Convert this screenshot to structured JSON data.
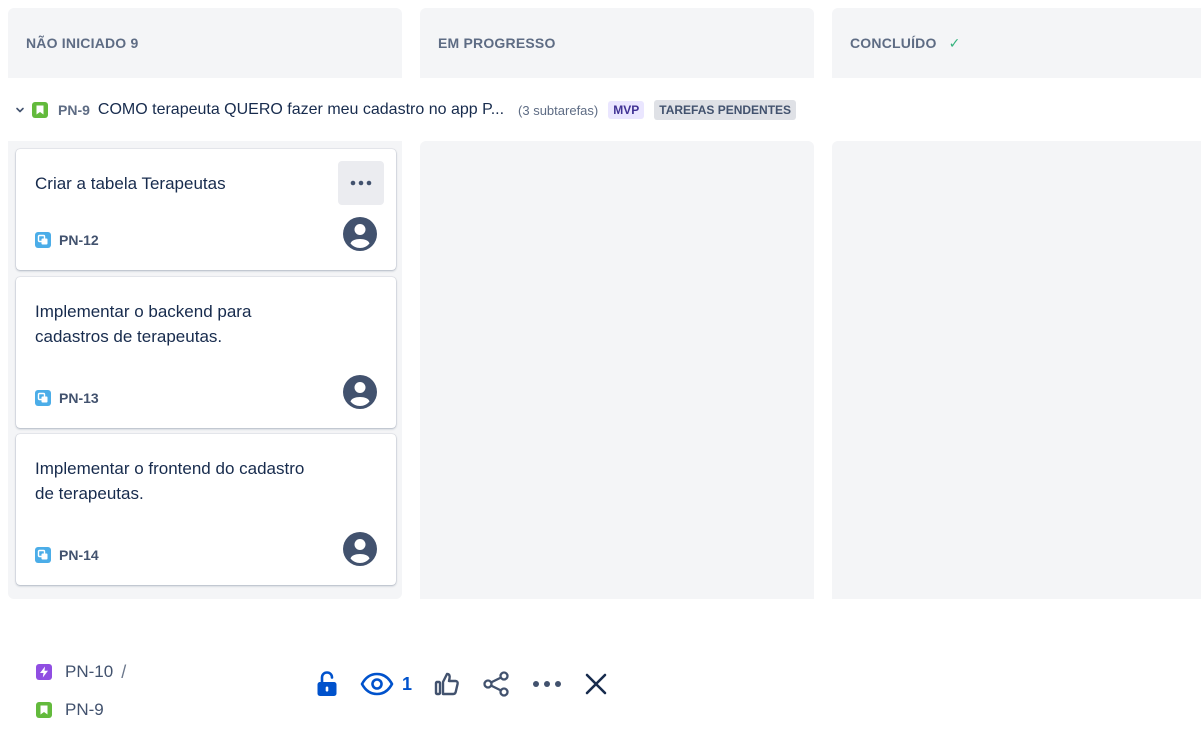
{
  "columns": [
    {
      "header": "NÃO INICIADO 9"
    },
    {
      "header": "EM PROGRESSO"
    },
    {
      "header": "CONCLUÍDO",
      "done_check": "✓"
    }
  ],
  "swimlane": {
    "key": "PN-9",
    "summary": "COMO terapeuta QUERO fazer meu cadastro no app P...",
    "subtask_count": "(3 subtarefas)",
    "label": "MVP",
    "status": "TAREFAS PENDENTES"
  },
  "cards": [
    {
      "title": "Criar a tabela Terapeutas",
      "key": "PN-12"
    },
    {
      "title": "Implementar o backend para cadastros de terapeutas.",
      "key": "PN-13"
    },
    {
      "title": "Implementar o frontend do cadastro de terapeutas.",
      "key": "PN-14"
    }
  ],
  "breadcrumb": {
    "parent_key": "PN-10",
    "separator": "/",
    "current_key": "PN-9"
  },
  "toolbar": {
    "watch_count": "1"
  },
  "colors": {
    "story": "#63ba3c",
    "subtask": "#4bade8",
    "epic": "#904ee2",
    "accent": "#0052cc",
    "done": "#36b37e"
  },
  "icons": [
    "chevron-down-icon",
    "story-icon",
    "subtask-icon",
    "epic-icon",
    "avatar-icon",
    "more-icon",
    "unlock-icon",
    "eye-icon",
    "thumbs-up-icon",
    "share-icon",
    "close-icon"
  ]
}
